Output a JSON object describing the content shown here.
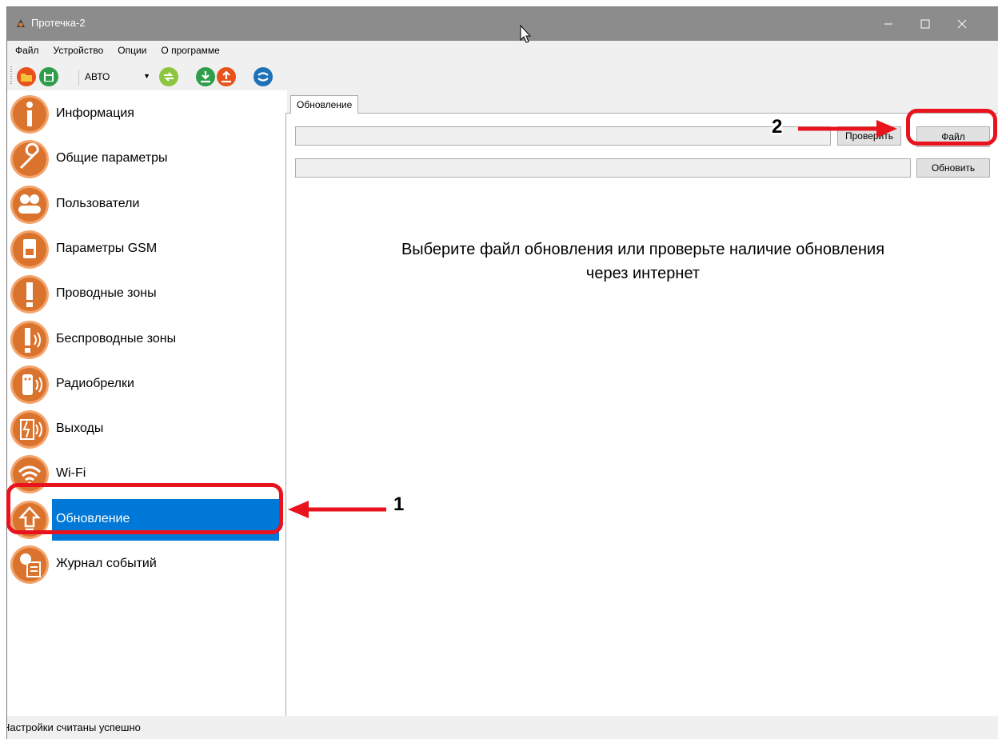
{
  "window": {
    "title": "Протечка-2",
    "minimize_icon": "minimize-icon",
    "maximize_icon": "maximize-icon",
    "close_icon": "close-icon"
  },
  "menu": {
    "items": [
      "Файл",
      "Устройство",
      "Опции",
      "О программе"
    ]
  },
  "toolbar": {
    "mode_value": "АВТО",
    "buttons": [
      "open-folder-icon",
      "save-icon",
      "connect-icon",
      "download-icon",
      "upload-icon",
      "sync-icon"
    ]
  },
  "sidebar": {
    "items": [
      {
        "label": "Информация",
        "icon": "info-icon"
      },
      {
        "label": "Общие параметры",
        "icon": "wrench-icon"
      },
      {
        "label": "Пользователи",
        "icon": "users-icon"
      },
      {
        "label": "Параметры GSM",
        "icon": "sim-card-icon"
      },
      {
        "label": "Проводные зоны",
        "icon": "exclamation-icon"
      },
      {
        "label": "Беспроводные зоны",
        "icon": "wireless-exclamation-icon"
      },
      {
        "label": "Радиобрелки",
        "icon": "remote-fob-icon"
      },
      {
        "label": "Выходы",
        "icon": "relay-output-icon"
      },
      {
        "label": "Wi-Fi",
        "icon": "wifi-icon"
      },
      {
        "label": "Обновление",
        "icon": "update-arrow-icon"
      },
      {
        "label": "Журнал событий",
        "icon": "event-log-icon"
      }
    ],
    "selected_index": 9
  },
  "main": {
    "tab_label": "Обновление",
    "file_path_value": "",
    "check_button_label": "Проверить",
    "file_button_label": "Файл",
    "update_field_value": "",
    "update_button_label": "Обновить",
    "message_line1": "Выберите файл обновления или проверьте наличие обновления",
    "message_line2": "через интернет"
  },
  "status": {
    "text": "Настройки считаны успешно"
  },
  "annotations": {
    "marker_1": "1",
    "marker_2": "2",
    "color": "#e8131c"
  },
  "colors": {
    "selected": "#0078d7",
    "icon_orange": "#d9732e",
    "titlebar": "#8c8c8c"
  }
}
